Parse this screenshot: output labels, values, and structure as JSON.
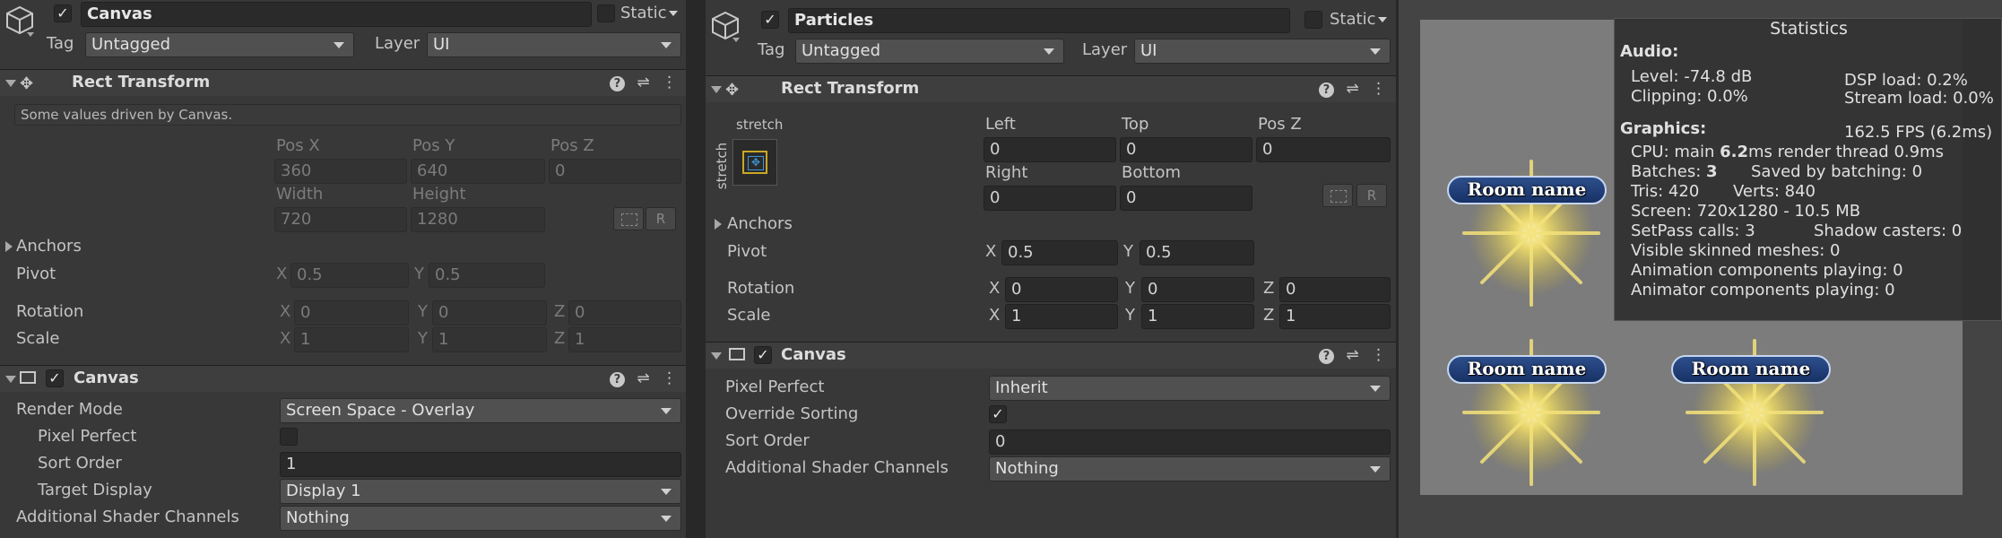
{
  "left": {
    "name": "Canvas",
    "static_label": "Static",
    "tag_label": "Tag",
    "tag_value": "Untagged",
    "layer_label": "Layer",
    "layer_value": "UI",
    "rect_title": "Rect Transform",
    "driven_note": "Some values driven by Canvas.",
    "pos_x_label": "Pos X",
    "pos_y_label": "Pos Y",
    "pos_z_label": "Pos Z",
    "pos_x": "360",
    "pos_y": "640",
    "pos_z": "0",
    "width_label": "Width",
    "height_label": "Height",
    "width": "720",
    "height": "1280",
    "r_btn": "R",
    "anchors_label": "Anchors",
    "pivot_label": "Pivot",
    "pivot_x": "0.5",
    "pivot_y": "0.5",
    "rotation_label": "Rotation",
    "rot_x": "0",
    "rot_y": "0",
    "rot_z": "0",
    "scale_label": "Scale",
    "scale_x": "1",
    "scale_y": "1",
    "scale_z": "1",
    "canvas_title": "Canvas",
    "render_mode_label": "Render Mode",
    "render_mode": "Screen Space - Overlay",
    "pixel_perfect_label": "Pixel Perfect",
    "sort_order_label": "Sort Order",
    "sort_order": "1",
    "target_display_label": "Target Display",
    "target_display": "Display 1",
    "shader_label": "Additional Shader Channels",
    "shader_value": "Nothing",
    "x": "X",
    "y": "Y",
    "z": "Z"
  },
  "middle": {
    "name": "Particles",
    "static_label": "Static",
    "tag_label": "Tag",
    "tag_value": "Untagged",
    "layer_label": "Layer",
    "layer_value": "UI",
    "rect_title": "Rect Transform",
    "stretch_top": "stretch",
    "stretch_side": "stretch",
    "left_label": "Left",
    "top_label": "Top",
    "pos_z_label": "Pos Z",
    "left": "0",
    "top": "0",
    "pos_z": "0",
    "right_label": "Right",
    "bottom_label": "Bottom",
    "right": "0",
    "bottom": "0",
    "r_btn": "R",
    "anchors_label": "Anchors",
    "pivot_label": "Pivot",
    "pivot_x": "0.5",
    "pivot_y": "0.5",
    "rotation_label": "Rotation",
    "rot_x": "0",
    "rot_y": "0",
    "rot_z": "0",
    "scale_label": "Scale",
    "scale_x": "1",
    "scale_y": "1",
    "scale_z": "1",
    "canvas_title": "Canvas",
    "pixel_perfect_label": "Pixel Perfect",
    "pixel_perfect": "Inherit",
    "override_label": "Override Sorting",
    "override_check": "✓",
    "sort_order_label": "Sort Order",
    "sort_order": "0",
    "shader_label": "Additional Shader Channels",
    "shader_value": "Nothing",
    "x": "X",
    "y": "Y",
    "z": "Z"
  },
  "game": {
    "room_labels": [
      "Room name",
      "Room name",
      "Room name"
    ],
    "stats": {
      "title": "Statistics",
      "audio": "Audio:",
      "level": "Level: -74.8 dB",
      "clipping": "Clipping: 0.0%",
      "dsp": "DSP load: 0.2%",
      "stream": "Stream load: 0.0%",
      "graphics": "Graphics:",
      "fps": "162.5 FPS (6.2ms)",
      "cpu_prefix": "CPU: main ",
      "cpu_main": "6.2",
      "cpu_suffix": "ms  render thread 0.9ms",
      "batches_prefix": "Batches: ",
      "batches": "3",
      "saved": "Saved by batching: 0",
      "tris": "Tris: 420",
      "verts": "Verts: 840",
      "screen": "Screen: 720x1280 - 10.5 MB",
      "setpass": "SetPass calls: 3",
      "shadow": "Shadow casters: 0",
      "skinned": "Visible skinned meshes: 0",
      "anim": "Animation components playing: 0",
      "animator": "Animator components playing: 0"
    }
  },
  "colors": {
    "panel": "#383838",
    "header": "#3e3e3e",
    "field": "#2a2a2a",
    "game_bg": "#7a7a7a",
    "label_blue": "#173166"
  }
}
